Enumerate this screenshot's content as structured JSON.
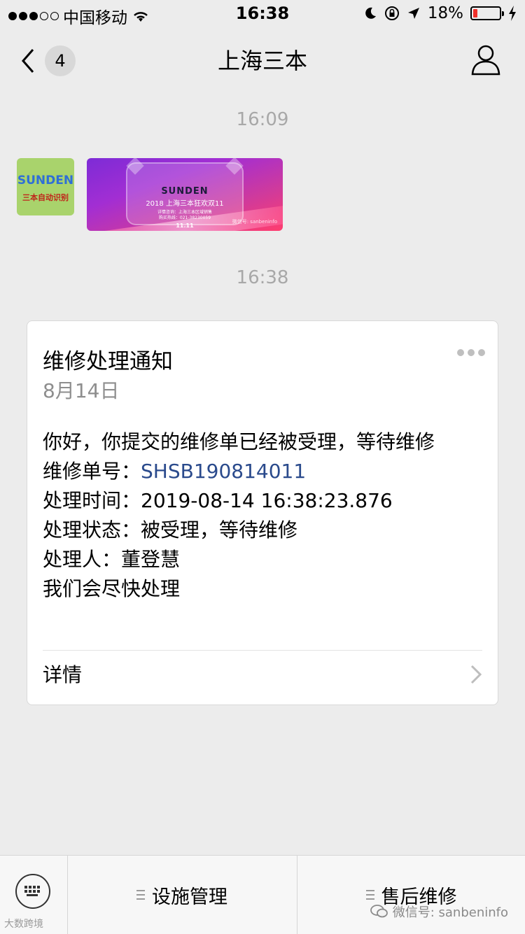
{
  "status_bar": {
    "carrier": "中国移动",
    "time": "16:38",
    "battery_percent": "18%",
    "battery_level": 0.18,
    "battery_color": "#f0302a"
  },
  "nav": {
    "unread_count": "4",
    "title": "上海三本",
    "back_icon": "chevron-left-icon",
    "profile_icon": "person-icon"
  },
  "messages": {
    "time_1": "16:09",
    "avatar_logo": "SUNDEN",
    "avatar_sub": "三本自动识别",
    "promo": {
      "brand": "SUNDEN",
      "title": "2018 上海三本狂欢双11",
      "line_1": "详情咨询：上海三本区域销售",
      "line_2": "购买热线：021-38230059",
      "watermark": "微信号: sanbeninfo",
      "badge": "11.11"
    },
    "time_2": "16:38"
  },
  "card": {
    "title": "维修处理通知",
    "date": "8月14日",
    "intro": "你好，你提交的维修单已经被受理，等待维修",
    "order_label": "维修单号：",
    "order_value": "SHSB190814011",
    "time_label": "处理时间：",
    "time_value": "2019-08-14 16:38:23.876",
    "status_label": "处理状态：",
    "status_value": "被受理，等待维修",
    "handler_label": "处理人：",
    "handler_value": "董登慧",
    "closing": "我们会尽快处理",
    "detail_label": "详情",
    "accent_color": "#2a4a8c"
  },
  "bottom_menu": {
    "keyboard_icon": "keyboard-icon",
    "item_1": "设施管理",
    "item_2": "售后维修"
  },
  "watermarks": {
    "left": "大数跨境",
    "right": "微信号: sanbeninfo"
  }
}
